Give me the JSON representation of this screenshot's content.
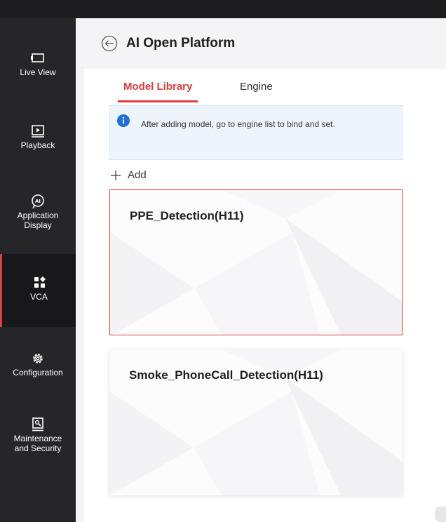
{
  "sidebar": {
    "items": [
      {
        "label": "Live View",
        "icon": "live-view-icon",
        "active": false
      },
      {
        "label": "Playback",
        "icon": "playback-icon",
        "active": false
      },
      {
        "label": "Application\nDisplay",
        "icon": "ai-icon",
        "active": false
      },
      {
        "label": "VCA",
        "icon": "vca-icon",
        "active": true
      },
      {
        "label": "Configuration",
        "icon": "gear-icon",
        "active": false
      },
      {
        "label": "Maintenance\nand Security",
        "icon": "maintenance-icon",
        "active": false
      }
    ]
  },
  "header": {
    "title": "AI Open Platform"
  },
  "tabs": [
    {
      "label": "Model Library",
      "active": true
    },
    {
      "label": "Engine",
      "active": false
    }
  ],
  "notice": {
    "text": "After adding model, go to engine list to bind and set."
  },
  "toolbar": {
    "add_label": "Add"
  },
  "models": [
    {
      "name": "PPE_Detection(H11)",
      "selected": true
    },
    {
      "name": "Smoke_PhoneCall_Detection(H11)",
      "selected": false
    }
  ],
  "colors": {
    "accent": "#e23c3c",
    "sidebar_bg": "#262629",
    "notice_bg": "#eef4fc",
    "info_blue": "#1f6fe0"
  }
}
